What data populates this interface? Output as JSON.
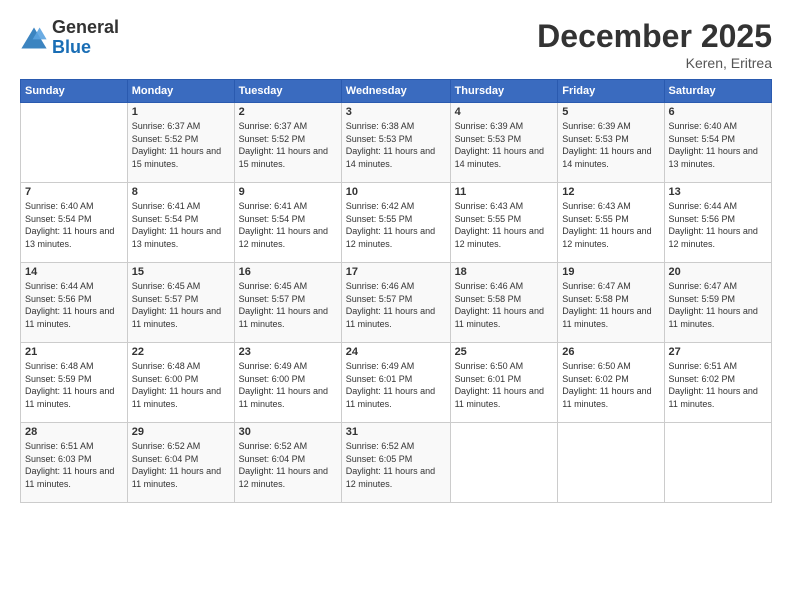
{
  "logo": {
    "general": "General",
    "blue": "Blue"
  },
  "title": "December 2025",
  "location": "Keren, Eritrea",
  "days_header": [
    "Sunday",
    "Monday",
    "Tuesday",
    "Wednesday",
    "Thursday",
    "Friday",
    "Saturday"
  ],
  "weeks": [
    [
      {
        "day": "",
        "sunrise": "",
        "sunset": "",
        "daylight": ""
      },
      {
        "day": "1",
        "sunrise": "Sunrise: 6:37 AM",
        "sunset": "Sunset: 5:52 PM",
        "daylight": "Daylight: 11 hours and 15 minutes."
      },
      {
        "day": "2",
        "sunrise": "Sunrise: 6:37 AM",
        "sunset": "Sunset: 5:52 PM",
        "daylight": "Daylight: 11 hours and 15 minutes."
      },
      {
        "day": "3",
        "sunrise": "Sunrise: 6:38 AM",
        "sunset": "Sunset: 5:53 PM",
        "daylight": "Daylight: 11 hours and 14 minutes."
      },
      {
        "day": "4",
        "sunrise": "Sunrise: 6:39 AM",
        "sunset": "Sunset: 5:53 PM",
        "daylight": "Daylight: 11 hours and 14 minutes."
      },
      {
        "day": "5",
        "sunrise": "Sunrise: 6:39 AM",
        "sunset": "Sunset: 5:53 PM",
        "daylight": "Daylight: 11 hours and 14 minutes."
      },
      {
        "day": "6",
        "sunrise": "Sunrise: 6:40 AM",
        "sunset": "Sunset: 5:54 PM",
        "daylight": "Daylight: 11 hours and 13 minutes."
      }
    ],
    [
      {
        "day": "7",
        "sunrise": "Sunrise: 6:40 AM",
        "sunset": "Sunset: 5:54 PM",
        "daylight": "Daylight: 11 hours and 13 minutes."
      },
      {
        "day": "8",
        "sunrise": "Sunrise: 6:41 AM",
        "sunset": "Sunset: 5:54 PM",
        "daylight": "Daylight: 11 hours and 13 minutes."
      },
      {
        "day": "9",
        "sunrise": "Sunrise: 6:41 AM",
        "sunset": "Sunset: 5:54 PM",
        "daylight": "Daylight: 11 hours and 12 minutes."
      },
      {
        "day": "10",
        "sunrise": "Sunrise: 6:42 AM",
        "sunset": "Sunset: 5:55 PM",
        "daylight": "Daylight: 11 hours and 12 minutes."
      },
      {
        "day": "11",
        "sunrise": "Sunrise: 6:43 AM",
        "sunset": "Sunset: 5:55 PM",
        "daylight": "Daylight: 11 hours and 12 minutes."
      },
      {
        "day": "12",
        "sunrise": "Sunrise: 6:43 AM",
        "sunset": "Sunset: 5:55 PM",
        "daylight": "Daylight: 11 hours and 12 minutes."
      },
      {
        "day": "13",
        "sunrise": "Sunrise: 6:44 AM",
        "sunset": "Sunset: 5:56 PM",
        "daylight": "Daylight: 11 hours and 12 minutes."
      }
    ],
    [
      {
        "day": "14",
        "sunrise": "Sunrise: 6:44 AM",
        "sunset": "Sunset: 5:56 PM",
        "daylight": "Daylight: 11 hours and 11 minutes."
      },
      {
        "day": "15",
        "sunrise": "Sunrise: 6:45 AM",
        "sunset": "Sunset: 5:57 PM",
        "daylight": "Daylight: 11 hours and 11 minutes."
      },
      {
        "day": "16",
        "sunrise": "Sunrise: 6:45 AM",
        "sunset": "Sunset: 5:57 PM",
        "daylight": "Daylight: 11 hours and 11 minutes."
      },
      {
        "day": "17",
        "sunrise": "Sunrise: 6:46 AM",
        "sunset": "Sunset: 5:57 PM",
        "daylight": "Daylight: 11 hours and 11 minutes."
      },
      {
        "day": "18",
        "sunrise": "Sunrise: 6:46 AM",
        "sunset": "Sunset: 5:58 PM",
        "daylight": "Daylight: 11 hours and 11 minutes."
      },
      {
        "day": "19",
        "sunrise": "Sunrise: 6:47 AM",
        "sunset": "Sunset: 5:58 PM",
        "daylight": "Daylight: 11 hours and 11 minutes."
      },
      {
        "day": "20",
        "sunrise": "Sunrise: 6:47 AM",
        "sunset": "Sunset: 5:59 PM",
        "daylight": "Daylight: 11 hours and 11 minutes."
      }
    ],
    [
      {
        "day": "21",
        "sunrise": "Sunrise: 6:48 AM",
        "sunset": "Sunset: 5:59 PM",
        "daylight": "Daylight: 11 hours and 11 minutes."
      },
      {
        "day": "22",
        "sunrise": "Sunrise: 6:48 AM",
        "sunset": "Sunset: 6:00 PM",
        "daylight": "Daylight: 11 hours and 11 minutes."
      },
      {
        "day": "23",
        "sunrise": "Sunrise: 6:49 AM",
        "sunset": "Sunset: 6:00 PM",
        "daylight": "Daylight: 11 hours and 11 minutes."
      },
      {
        "day": "24",
        "sunrise": "Sunrise: 6:49 AM",
        "sunset": "Sunset: 6:01 PM",
        "daylight": "Daylight: 11 hours and 11 minutes."
      },
      {
        "day": "25",
        "sunrise": "Sunrise: 6:50 AM",
        "sunset": "Sunset: 6:01 PM",
        "daylight": "Daylight: 11 hours and 11 minutes."
      },
      {
        "day": "26",
        "sunrise": "Sunrise: 6:50 AM",
        "sunset": "Sunset: 6:02 PM",
        "daylight": "Daylight: 11 hours and 11 minutes."
      },
      {
        "day": "27",
        "sunrise": "Sunrise: 6:51 AM",
        "sunset": "Sunset: 6:02 PM",
        "daylight": "Daylight: 11 hours and 11 minutes."
      }
    ],
    [
      {
        "day": "28",
        "sunrise": "Sunrise: 6:51 AM",
        "sunset": "Sunset: 6:03 PM",
        "daylight": "Daylight: 11 hours and 11 minutes."
      },
      {
        "day": "29",
        "sunrise": "Sunrise: 6:52 AM",
        "sunset": "Sunset: 6:04 PM",
        "daylight": "Daylight: 11 hours and 11 minutes."
      },
      {
        "day": "30",
        "sunrise": "Sunrise: 6:52 AM",
        "sunset": "Sunset: 6:04 PM",
        "daylight": "Daylight: 11 hours and 12 minutes."
      },
      {
        "day": "31",
        "sunrise": "Sunrise: 6:52 AM",
        "sunset": "Sunset: 6:05 PM",
        "daylight": "Daylight: 11 hours and 12 minutes."
      },
      {
        "day": "",
        "sunrise": "",
        "sunset": "",
        "daylight": ""
      },
      {
        "day": "",
        "sunrise": "",
        "sunset": "",
        "daylight": ""
      },
      {
        "day": "",
        "sunrise": "",
        "sunset": "",
        "daylight": ""
      }
    ]
  ]
}
